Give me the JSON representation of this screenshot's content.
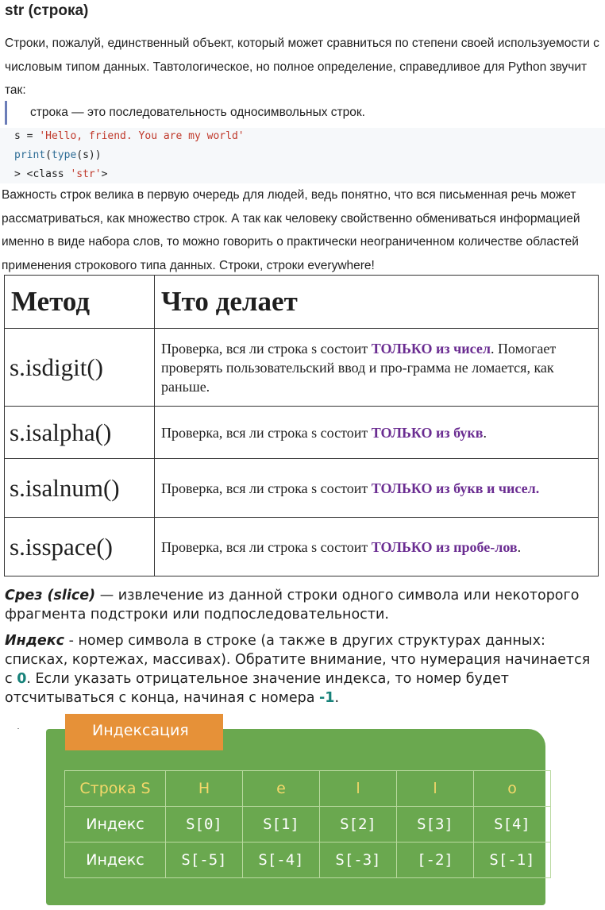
{
  "heading": "str (строка)",
  "para1": "Строки, пожалуй, единственный объект, который может сравниться по степени своей используемости с числовым типом данных. Тавтологическое, но полное определение, справедливое для Python звучит так:",
  "quote": "строка — это последовательность односимвольных строк.",
  "code": {
    "line1_var": "s = ",
    "line1_str": "'Hello, friend. You are my world'",
    "line2_print": "print",
    "line2_open": "(",
    "line2_type": "type",
    "line2_rest": "(s))",
    "line3_prefix": "> <class ",
    "line3_str": "'str'",
    "line3_end": ">"
  },
  "para2": "Важность строк велика в первую очередь для людей, ведь понятно, что вся письменная речь может рассматриваться, как множество строк. А так как человеку свойственно обмениваться информацией именно в виде набора слов, то можно говорить о практически неограниченном количестве областей применения строкового типа данных. Строки, строки everywhere!",
  "methods_table": {
    "header_method": "Метод",
    "header_desc": "Что делает",
    "rows": [
      {
        "method": "s.isdigit()",
        "pre": "Проверка, вся ли строка s состоит ",
        "hl": "ТОЛЬКО из чисел",
        "post": ". Помогает проверять пользовательский ввод и про-грамма не ломается, как раньше."
      },
      {
        "method": "s.isalpha()",
        "pre": "Проверка, вся ли строка s состоит ",
        "hl": "ТОЛЬКО из букв",
        "post": "."
      },
      {
        "method": "s.isalnum()",
        "pre": "Проверка, вся ли строка s состоит ",
        "hl": "ТОЛЬКО из букв и чисел.",
        "post": ""
      },
      {
        "method": "s.isspace()",
        "pre": "Проверка, вся ли строка s состоит ",
        "hl": "ТОЛЬКО из пробе-лов",
        "post": "."
      }
    ]
  },
  "slice": {
    "term": "Срез (slice)",
    "text": " — извлечение из данной строки одного символа или некоторого фрагмента подстроки или подпоследовательности."
  },
  "index": {
    "term": "Индекс",
    "text1": " - номер символа в строке (а также в других структурах данных: списках, кортежах, массивах). Обратите внимание, что нумерация начинается с ",
    "zero": "0",
    "text2": ". Если указать отрицательное значение индекса, то номер будет отсчитываться с конца, начиная с номера ",
    "minus_one": "-1",
    "text3": "."
  },
  "indexing_graphic": {
    "tab": "Индексация",
    "rows": [
      {
        "label": "Строка S",
        "cells": [
          "H",
          "e",
          "l",
          "l",
          "o"
        ]
      },
      {
        "label": "Индекс",
        "cells": [
          "S[0]",
          "S[1]",
          "S[2]",
          "S[3]",
          "S[4]"
        ]
      },
      {
        "label": "Индекс",
        "cells": [
          "S[-5]",
          "S[-4]",
          "S[-3]",
          "[-2]",
          "S[-1]"
        ]
      }
    ],
    "colors": {
      "panel": "#6aa84f",
      "tab": "#e69138",
      "header_text": "#f4d86a"
    }
  }
}
